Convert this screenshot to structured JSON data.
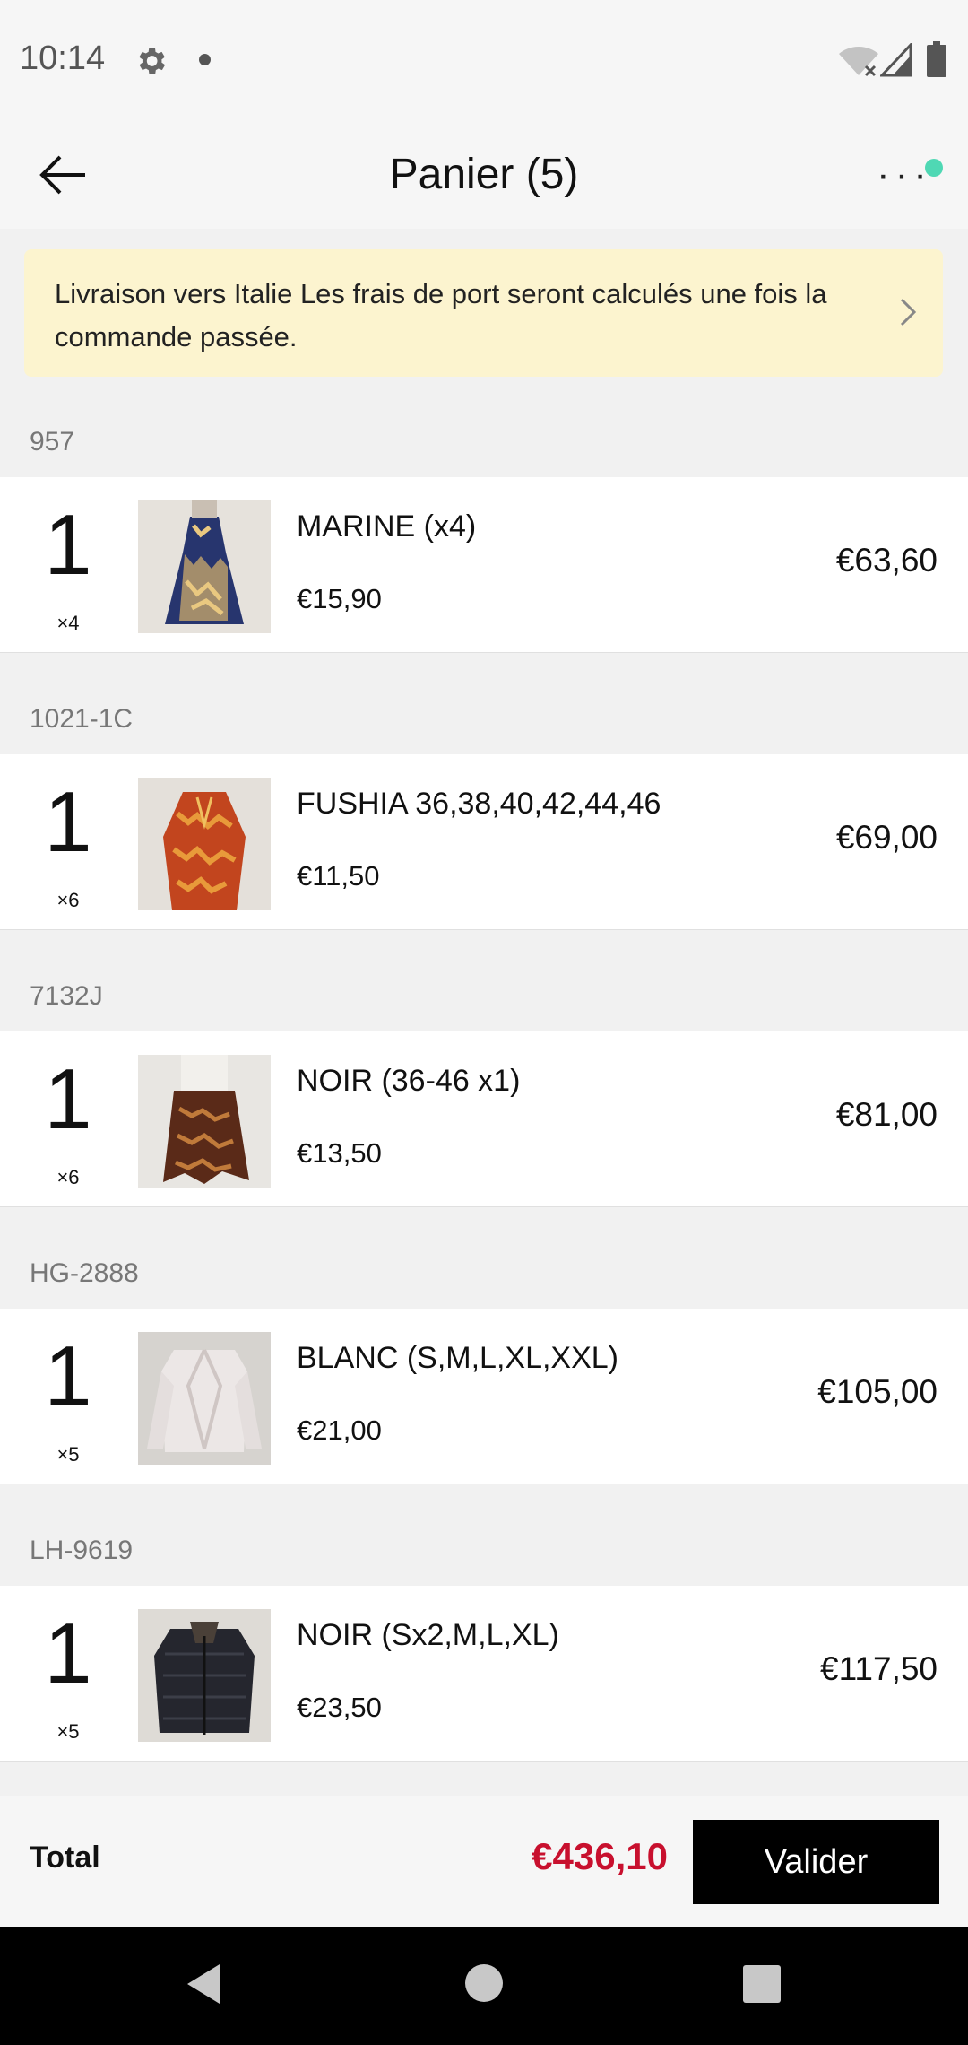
{
  "status_bar": {
    "time": "10:14",
    "icons": [
      "gear-icon",
      "notification-dot-icon",
      "wifi-off-icon",
      "cell-signal-icon",
      "battery-icon"
    ]
  },
  "header": {
    "title": "Panier (5)",
    "back_icon": "arrow-left-icon",
    "more_label": "···"
  },
  "shipping_banner": {
    "text": "Livraison vers  Italie Les frais de port seront calculés une fois la commande passée."
  },
  "items": [
    {
      "group": "957",
      "qty": "1",
      "multiplier": "×4",
      "name": "MARINE (x4)",
      "unit_price": "€15,90",
      "line_total": "€63,60",
      "image": "dress-navy-pattern"
    },
    {
      "group": "1021-1C",
      "qty": "1",
      "multiplier": "×6",
      "name": "FUSHIA 36,38,40,42,44,46",
      "unit_price": "€11,50",
      "line_total": "€69,00",
      "image": "blouse-orange-pattern"
    },
    {
      "group": "7132J",
      "qty": "1",
      "multiplier": "×6",
      "name": "NOIR (36-46 x1)",
      "unit_price": "€13,50",
      "line_total": "€81,00",
      "image": "skirt-brown-paisley"
    },
    {
      "group": "HG-2888",
      "qty": "1",
      "multiplier": "×5",
      "name": "BLANC (S,M,L,XL,XXL)",
      "unit_price": "€21,00",
      "line_total": "€105,00",
      "image": "jacket-white"
    },
    {
      "group": "LH-9619",
      "qty": "1",
      "multiplier": "×5",
      "name": "NOIR (Sx2,M,L,XL)",
      "unit_price": "€23,50",
      "line_total": "€117,50",
      "image": "puffer-jacket-black"
    }
  ],
  "footer": {
    "total_label": "Total",
    "total_amount": "€436,10",
    "validate_label": "Valider"
  },
  "colors": {
    "accent_price": "#c8102e",
    "banner_bg": "#fcf4cf",
    "notification_dot": "#4fd8b4",
    "button_bg": "#000000"
  }
}
